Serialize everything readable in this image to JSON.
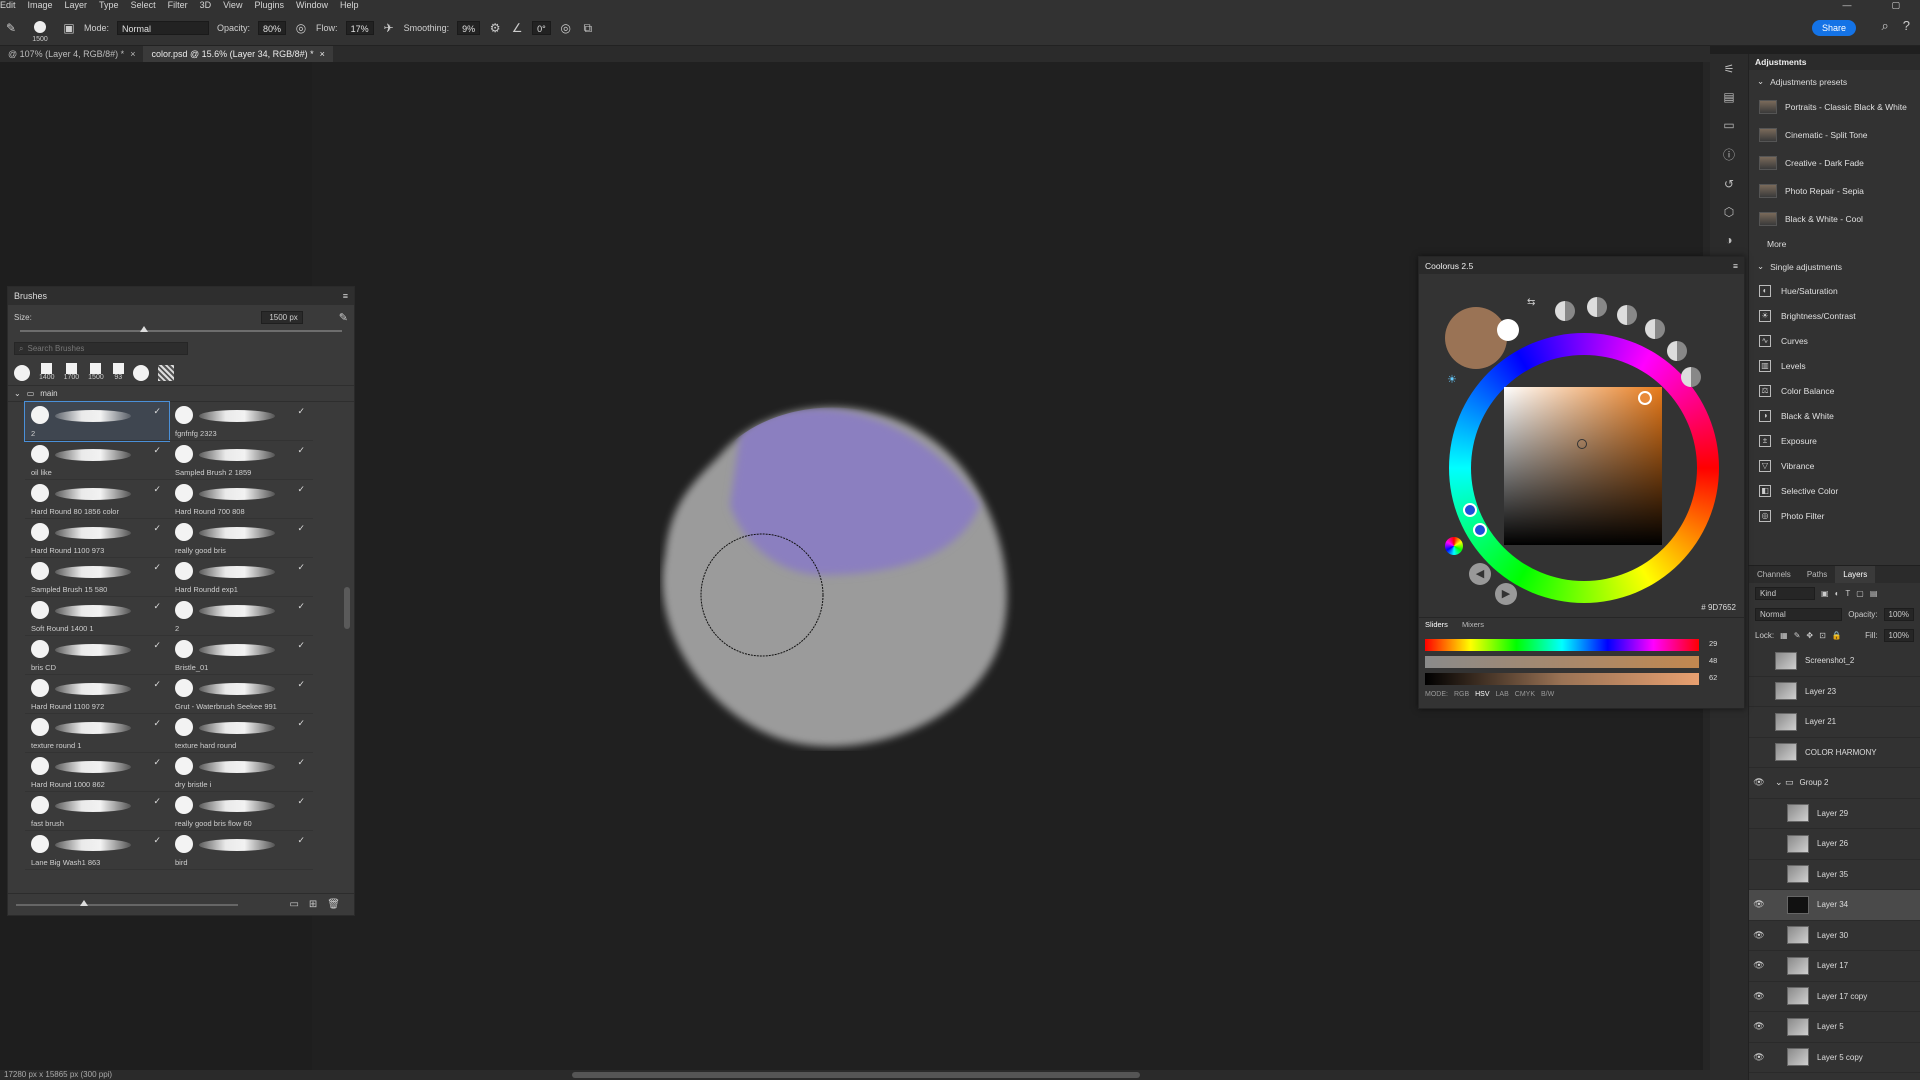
{
  "menu": [
    "Edit",
    "Image",
    "Layer",
    "Type",
    "Select",
    "Filter",
    "3D",
    "View",
    "Plugins",
    "Window",
    "Help"
  ],
  "options": {
    "mode_label": "Mode:",
    "mode_value": "Normal",
    "opacity_label": "Opacity:",
    "opacity_value": "80%",
    "flow_label": "Flow:",
    "flow_value": "17%",
    "smoothing_label": "Smoothing:",
    "smoothing_value": "9%",
    "angle_value": "0°",
    "brush_size": "1500",
    "share_label": "Share"
  },
  "tabs": [
    {
      "label": "@ 107% (Layer 4, RGB/8#) *",
      "active": false
    },
    {
      "label": "color.psd @ 15.6% (Layer 34, RGB/8#) *",
      "active": true
    }
  ],
  "status": "17280 px x 15865 px (300 ppi)",
  "brushes": {
    "title": "Brushes",
    "size_label": "Size:",
    "size_value": "1500 px",
    "search_placeholder": "Search Brushes",
    "presets": [
      "",
      "1400",
      "1700",
      "1500",
      "93",
      "",
      ""
    ],
    "folder": "main",
    "items": [
      {
        "name": "2",
        "sel": true
      },
      {
        "name": "fgnfnfg 2323"
      },
      {
        "name": "oil like"
      },
      {
        "name": "Sampled Brush 2 1859"
      },
      {
        "name": "Hard Round 80 1856 color"
      },
      {
        "name": "Hard Round 700 808"
      },
      {
        "name": "Hard Round 1100 973"
      },
      {
        "name": "really good bris"
      },
      {
        "name": "Sampled Brush 15 580"
      },
      {
        "name": "Hard Roundd exp1"
      },
      {
        "name": "Soft Round 1400 1"
      },
      {
        "name": "2"
      },
      {
        "name": "bris CD"
      },
      {
        "name": "Bristle_01"
      },
      {
        "name": "Hard Round 1100 972"
      },
      {
        "name": "Grut - Waterbrush Seekee 991"
      },
      {
        "name": "texture round 1"
      },
      {
        "name": "texture hard round"
      },
      {
        "name": "Hard Round 1000 862"
      },
      {
        "name": "dry bristle i"
      },
      {
        "name": "fast brush"
      },
      {
        "name": "really good bris flow 60"
      },
      {
        "name": "Lane Big Wash1 863"
      },
      {
        "name": "bird"
      }
    ]
  },
  "adjustments": {
    "title": "Adjustments",
    "presets_title": "Adjustments presets",
    "presets": [
      "Portraits - Classic Black & White",
      "Cinematic - Split Tone",
      "Creative - Dark Fade",
      "Photo Repair - Sepia",
      "Black & White - Cool"
    ],
    "more": "More",
    "single_title": "Single adjustments",
    "single": [
      "Hue/Saturation",
      "Brightness/Contrast",
      "Curves",
      "Levels",
      "Color Balance",
      "Black & White",
      "Exposure",
      "Vibrance",
      "Selective Color",
      "Photo Filter"
    ]
  },
  "layers": {
    "tabs": [
      "Channels",
      "Paths",
      "Layers"
    ],
    "kind": "Kind",
    "blend": "Normal",
    "opacity_label": "Opacity:",
    "opacity_value": "100%",
    "lock_label": "Lock:",
    "fill_label": "Fill:",
    "fill_value": "100%",
    "rows": [
      {
        "name": "Screenshot_2",
        "eye": false,
        "indent": false
      },
      {
        "name": "Layer 23",
        "eye": false,
        "indent": false
      },
      {
        "name": "Layer 21",
        "eye": false,
        "indent": false
      },
      {
        "name": "COLOR HARMONY",
        "eye": false,
        "indent": false
      },
      {
        "name": "Group 2",
        "eye": true,
        "group": true
      },
      {
        "name": "Layer 29",
        "eye": false,
        "indent": true
      },
      {
        "name": "Layer 26",
        "eye": false,
        "indent": true
      },
      {
        "name": "Layer 35",
        "eye": false,
        "indent": true
      },
      {
        "name": "Layer 34",
        "eye": true,
        "indent": true,
        "sel": true
      },
      {
        "name": "Layer 30",
        "eye": true,
        "indent": true
      },
      {
        "name": "Layer 17",
        "eye": true,
        "indent": true
      },
      {
        "name": "Layer 17 copy",
        "eye": true,
        "indent": true
      },
      {
        "name": "Layer 5",
        "eye": true,
        "indent": true
      },
      {
        "name": "Layer 5 copy",
        "eye": true,
        "indent": true
      }
    ]
  },
  "coolorus": {
    "title": "Coolorus 2.5",
    "hex": "# 9D7652",
    "subtabs": [
      "Sliders",
      "Mixers"
    ],
    "values": [
      "29",
      "48",
      "62"
    ],
    "modes": [
      "MODE:",
      "RGB",
      "HSV",
      "LAB",
      "CMYK",
      "B/W"
    ],
    "current_color": "#9a7355"
  }
}
